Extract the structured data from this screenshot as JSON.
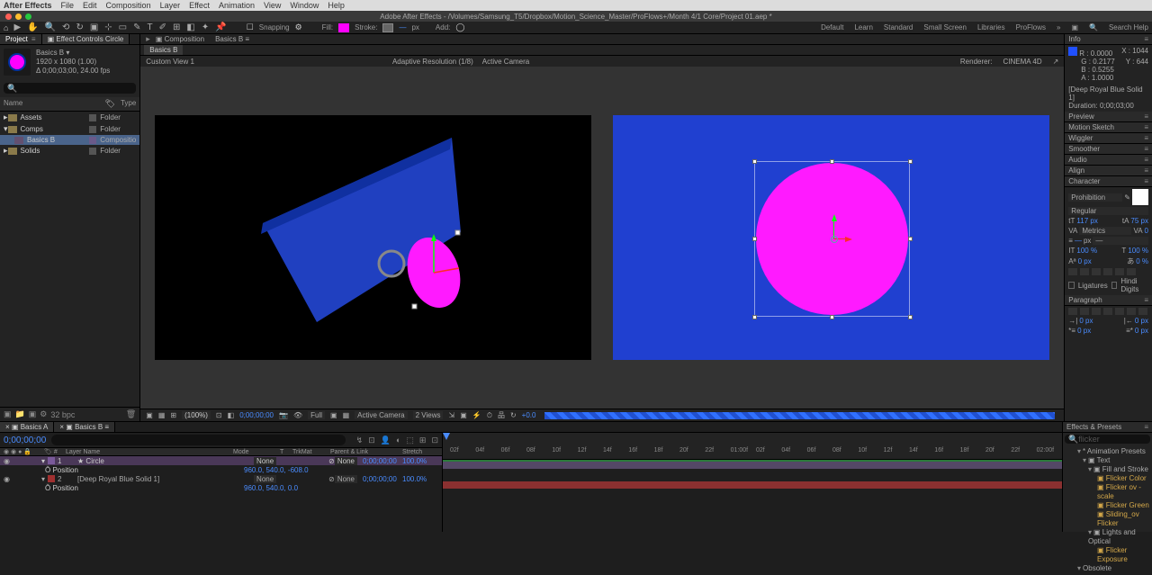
{
  "menubar": {
    "app": "After Effects",
    "items": [
      "File",
      "Edit",
      "Composition",
      "Layer",
      "Effect",
      "Animation",
      "View",
      "Window",
      "Help"
    ]
  },
  "titlebar": {
    "title": "Adobe After Effects - /Volumes/Samsung_T5/Dropbox/Motion_Science_Master/ProFlows+/Month 4/1 Core/Project 01.aep *"
  },
  "ribbon": {
    "snapping": "Snapping",
    "fill": "Fill:",
    "stroke": "Stroke:",
    "px": "px",
    "add": "Add:",
    "workspaces": [
      "Default",
      "Learn",
      "Standard",
      "Small Screen",
      "Libraries",
      "ProFlows"
    ],
    "search": "Search Help"
  },
  "left_panel": {
    "tabs": {
      "project": "Project",
      "fx": "Effect Controls Circle"
    },
    "item_name": "Basics B ▾",
    "item_dim": "1920 x 1080 (1.00)",
    "item_dur": "Δ 0;00;03;00, 24.00 fps",
    "cols": {
      "name": "Name",
      "type": "Type"
    },
    "rows": [
      {
        "name": "Assets",
        "type": "Folder",
        "kind": "folder"
      },
      {
        "name": "Comps",
        "type": "Folder",
        "kind": "folder"
      },
      {
        "name": "Basics B",
        "type": "Compositio",
        "kind": "comp"
      },
      {
        "name": "Solids",
        "type": "Folder",
        "kind": "folder"
      }
    ],
    "footer_bpc": "32 bpc"
  },
  "comp": {
    "crumbA": "Composition",
    "crumbB": "Basics B",
    "tab2": "Basics B",
    "view_label": "Custom View 1",
    "adaptive": "Adaptive Resolution (1/8)",
    "camera": "Active Camera",
    "renderer_label": "Renderer:",
    "renderer": "CINEMA 4D"
  },
  "footer": {
    "zoom": "(100%)",
    "time": "0;00;00;00",
    "res": "Full",
    "camera": "Active Camera",
    "views": "2 Views",
    "yval": "+0.0"
  },
  "info": {
    "title": "Info",
    "r_l": "R :",
    "g_l": "G :",
    "b_l": "B :",
    "a_l": "A :",
    "r": "0.0000",
    "g": "0.2177",
    "b": "0.5255",
    "a": "1.0000",
    "x_l": "X :",
    "y_l": "Y :",
    "x": "1044",
    "y": "644",
    "sel": "[Deep Royal Blue Solid 1]",
    "dur": "Duration: 0;00;03;00"
  },
  "panels": {
    "preview": "Preview",
    "sketch": "Motion Sketch",
    "wiggler": "Wiggler",
    "smoother": "Smoother",
    "audio": "Audio",
    "align": "Align"
  },
  "char": {
    "title": "Character",
    "font": "Prohibition",
    "weight": "Regular",
    "size_l": "tT",
    "size": "117 px",
    "lead_l": "tA",
    "lead": "75 px",
    "kern": "Metrics",
    "track": "0",
    "vscale": "100 %",
    "hscale": "100 %",
    "baseline": "0 px",
    "tsume": "0 %",
    "lig": "Ligatures",
    "hindi": "Hindi Digits",
    "px": "px",
    "fill": "—",
    "stroke": "—"
  },
  "para": {
    "title": "Paragraph",
    "l1": "0 px",
    "r1": "0 px",
    "l2": "0 px",
    "r2": "0 px",
    "l3": "0 px",
    "r3": "0 px"
  },
  "timeline": {
    "tabs": {
      "a": "Basics A",
      "b": "Basics B"
    },
    "tc": "0;00;00;00",
    "cols": {
      "layer": "Layer Name",
      "mode": "Mode",
      "t": "T",
      "trkmat": "TrkMat",
      "parent": "Parent & Link",
      "stretch": "Stretch"
    },
    "rows": {
      "circle": {
        "num": "1",
        "name": "Circle",
        "mode": "None",
        "time": "0;00;00;00",
        "stretch": "100.0%"
      },
      "circle_pos": {
        "name": "Position",
        "val": "960.0, 540.0, -608.0"
      },
      "solid": {
        "num": "2",
        "name": "[Deep Royal Blue Solid 1]",
        "mode": "None",
        "time": "0;00;00;00",
        "stretch": "100.0%"
      },
      "solid_pos": {
        "name": "Position",
        "val": "960.0, 540.0, 0.0"
      }
    },
    "ruler": [
      "02f",
      "04f",
      "06f",
      "08f",
      "10f",
      "12f",
      "14f",
      "16f",
      "18f",
      "20f",
      "22f",
      "01:00f",
      "02f",
      "04f",
      "06f",
      "08f",
      "10f",
      "12f",
      "14f",
      "16f",
      "18f",
      "20f",
      "22f",
      "02:00f"
    ]
  },
  "fx": {
    "title": "Effects & Presets",
    "search": "flicker",
    "cats": {
      "ap": "* Animation Presets",
      "text": "Text",
      "fs": "Fill and Stroke",
      "items1": [
        "Flicker Color",
        "Flicker ov - scale",
        "Flicker Green",
        "Sliding_ov Flicker"
      ],
      "lo": "Lights and Optical",
      "items2": [
        "Flicker Exposure"
      ],
      "obs": "Obsolete"
    }
  }
}
